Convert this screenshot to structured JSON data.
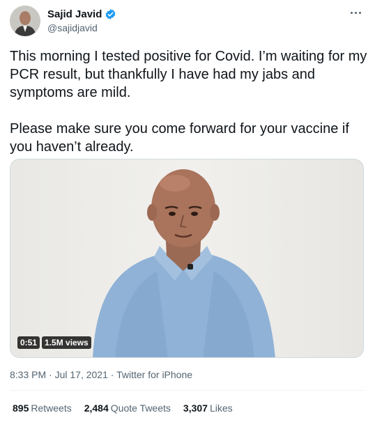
{
  "header": {
    "display_name": "Sajid Javid",
    "handle": "@sajidjavid",
    "verified_icon": "verified-badge-icon",
    "more_icon": "more-options-icon"
  },
  "tweet": {
    "paragraphs": [
      "This morning I tested positive for Covid. I’m waiting for my PCR result, but thankfully I have had my jabs and symptoms are mild.",
      "Please make sure you come forward for your vaccine if you haven’t already."
    ]
  },
  "media": {
    "duration": "0:51",
    "views": "1.5M views"
  },
  "meta": {
    "time": "8:33 PM",
    "separator": "·",
    "date": "Jul 17, 2021",
    "source": "Twitter for iPhone"
  },
  "stats": {
    "retweets_count": "895",
    "retweets_label": "Retweets",
    "quotes_count": "2,484",
    "quotes_label": "Quote Tweets",
    "likes_count": "3,307",
    "likes_label": "Likes"
  },
  "colors": {
    "text": "#0f1419",
    "secondary": "#536471",
    "verified": "#1d9bf0",
    "divider": "#eff3f4"
  }
}
